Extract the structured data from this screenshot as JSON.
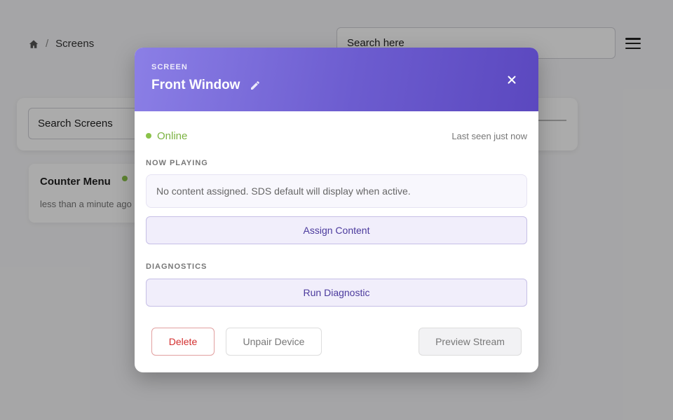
{
  "breadcrumb": {
    "home_icon": "home-icon",
    "separator": "/",
    "current": "Screens"
  },
  "header": {
    "search_placeholder": "Search here",
    "menu_icon": "hamburger-icon"
  },
  "filters": {
    "search_placeholder": "Search Screens"
  },
  "screens": [
    {
      "name": "Counter Menu",
      "status_color": "#8bc34a",
      "last_seen": "less than a minute ago"
    }
  ],
  "modal": {
    "eyebrow": "SCREEN",
    "title": "Front Window",
    "edit_icon": "pencil-icon",
    "close_icon": "close-icon",
    "status": "Online",
    "status_color": "#8bc34a",
    "last_seen": "Last seen just now",
    "now_playing_label": "NOW PLAYING",
    "now_playing_text": "No content assigned. SDS default will display when active.",
    "assign_button": "Assign Content",
    "diagnostics_label": "DIAGNOSTICS",
    "diagnostic_button": "Run Diagnostic",
    "delete_button": "Delete",
    "unpair_button": "Unpair Device",
    "preview_button": "Preview Stream",
    "accent_color": "#6c5ccf",
    "danger_color": "#d32f2f"
  }
}
